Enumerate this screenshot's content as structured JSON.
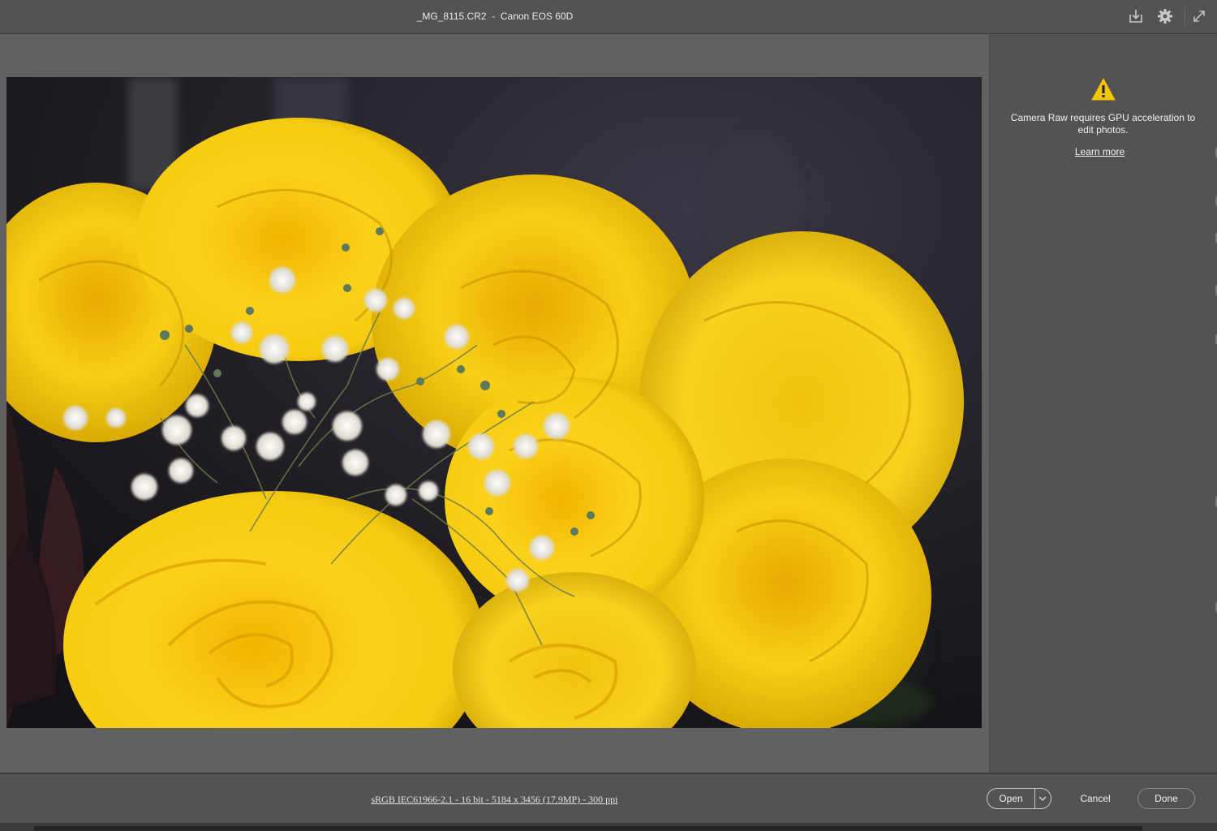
{
  "window": {
    "title": "_MG_8115.CR2  -  Canon EOS 60D"
  },
  "toolbar": {
    "icons": [
      "save-icon",
      "gear-icon",
      "fullscreen-icon"
    ]
  },
  "photo": {
    "subject": "yellow roses with baby's breath"
  },
  "panel": {
    "message": "Camera Raw requires GPU acceleration to edit photos.",
    "learn_more": "Learn more",
    "warning_color": "#f5c400"
  },
  "footer": {
    "workflow": "sRGB IEC61966-2.1 - 16 bit - 5184 x 3456 (17.9MP) - 300 ppi",
    "open_label": "Open",
    "cancel_label": "Cancel",
    "done_label": "Done"
  }
}
